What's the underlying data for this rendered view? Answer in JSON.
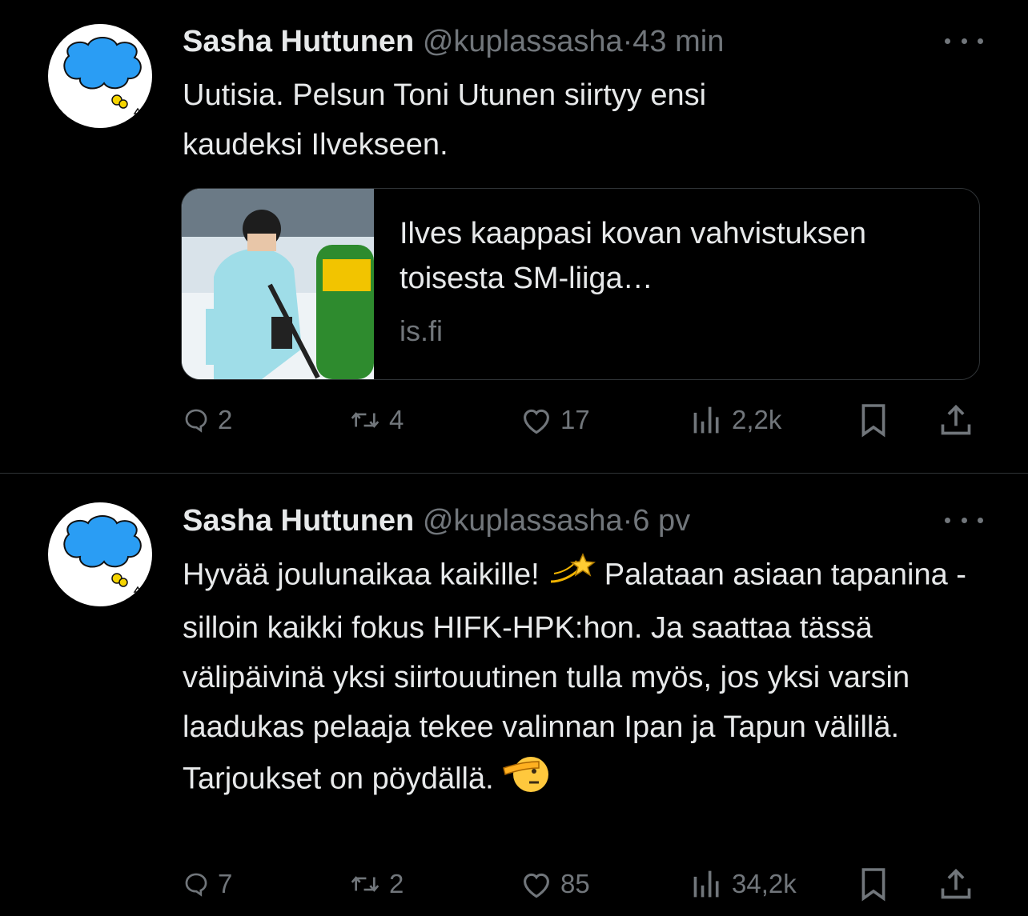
{
  "tweets": [
    {
      "author_name": "Sasha Huttunen",
      "handle": "@kuplassasha",
      "separator": "·",
      "time": "43 min",
      "text": "Uutisia. Pelsun Toni Utunen siirtyy ensi\nkaudeksi Ilvekseen.",
      "card": {
        "title": "Ilves kaappasi kovan vahvistuksen toisesta SM-liiga…",
        "domain": "is.fi"
      },
      "replies": "2",
      "reposts": "4",
      "likes": "17",
      "views": "2,2k"
    },
    {
      "author_name": "Sasha Huttunen",
      "handle": "@kuplassasha",
      "separator": "·",
      "time": "6 pv",
      "text_part1": "Hyvää joulunaikaa kaikille! ",
      "text_part2": " Palataan asiaan tapanina - silloin kaikki fokus HIFK-HPK:hon. Ja saattaa tässä välipäivinä yksi siirtouutinen tulla myös, jos yksi varsin laadukas pelaaja tekee valinnan Ipan ja Tapun välillä. Tarjoukset on pöydällä. ",
      "emoji1": "dizzy-emoji",
      "emoji2": "saluting-face-emoji",
      "replies": "7",
      "reposts": "2",
      "likes": "85",
      "views": "34,2k"
    }
  ],
  "colors": {
    "background": "#000000",
    "text": "#e7e9ea",
    "secondary": "#71767b",
    "border": "#2f3336",
    "avatar_cloud": "#2a9df4",
    "card_ice": "#9fdde8",
    "card_green": "#2e8b2e"
  }
}
